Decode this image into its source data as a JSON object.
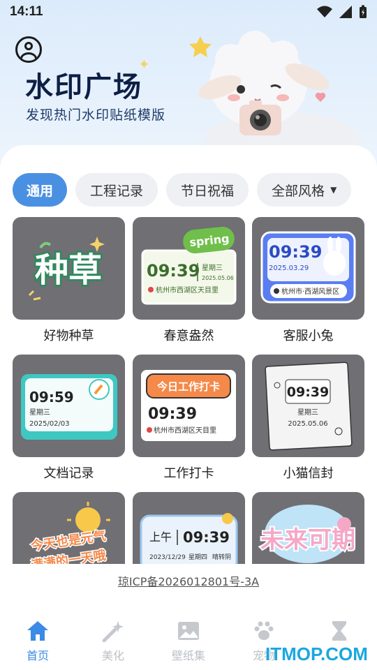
{
  "status_bar": {
    "time": "14:11"
  },
  "hero": {
    "title": "水印广场",
    "subtitle": "发现热门水印贴纸模版"
  },
  "chips": [
    {
      "label": "通用",
      "active": true
    },
    {
      "label": "工程记录",
      "active": false
    },
    {
      "label": "节日祝福",
      "active": false
    },
    {
      "label": "全部风格",
      "active": false,
      "dropdown": true
    }
  ],
  "templates": [
    {
      "label": "好物种草",
      "thumb": {
        "text": "种草"
      }
    },
    {
      "label": "春意盎然",
      "thumb": {
        "badge": "spring",
        "time": "09:39",
        "weekday": "星期三",
        "date": "2025.05.06",
        "location": "杭州市西湖区天目里"
      }
    },
    {
      "label": "客服小兔",
      "thumb": {
        "time": "09:39",
        "date": "2025.03.29",
        "location": "杭州市·西湖风景区"
      }
    },
    {
      "label": "文档记录",
      "thumb": {
        "time": "09:59",
        "weekday": "星期三",
        "date": "2025/02/03"
      }
    },
    {
      "label": "工作打卡",
      "thumb": {
        "header": "今日工作打卡",
        "time": "09:39",
        "location": "杭州市西湖区天目里"
      }
    },
    {
      "label": "小猫信封",
      "thumb": {
        "time": "09:39",
        "weekday": "星期三",
        "date": "2025.05.06"
      }
    },
    {
      "label": "",
      "thumb": {
        "text_line1": "今天也是元气",
        "text_line2": "满满的一天哦"
      }
    },
    {
      "label": "",
      "thumb": {
        "ampm": "上午",
        "time": "09:39",
        "date": "2023/12/29",
        "weekday": "星期四",
        "weather": "晴转阴"
      }
    },
    {
      "label": "",
      "thumb": {
        "text": "未来可期"
      }
    }
  ],
  "icp": "琼ICP备2026012801号-3A",
  "tabs": [
    {
      "label": "首页",
      "active": true,
      "icon": "home-icon"
    },
    {
      "label": "美化",
      "active": false,
      "icon": "magic-wand-icon"
    },
    {
      "label": "壁纸集",
      "active": false,
      "icon": "image-icon"
    },
    {
      "label": "宠物",
      "active": false,
      "icon": "paw-icon"
    },
    {
      "label": "",
      "active": false,
      "icon": "hourglass-icon"
    }
  ],
  "watermark": "ITMOP.COM",
  "colors": {
    "accent": "#4a90e2",
    "thumb_bg": "#6f6f74",
    "hero_bg": "#dcebfb",
    "tab_active": "#3b8ae6"
  }
}
